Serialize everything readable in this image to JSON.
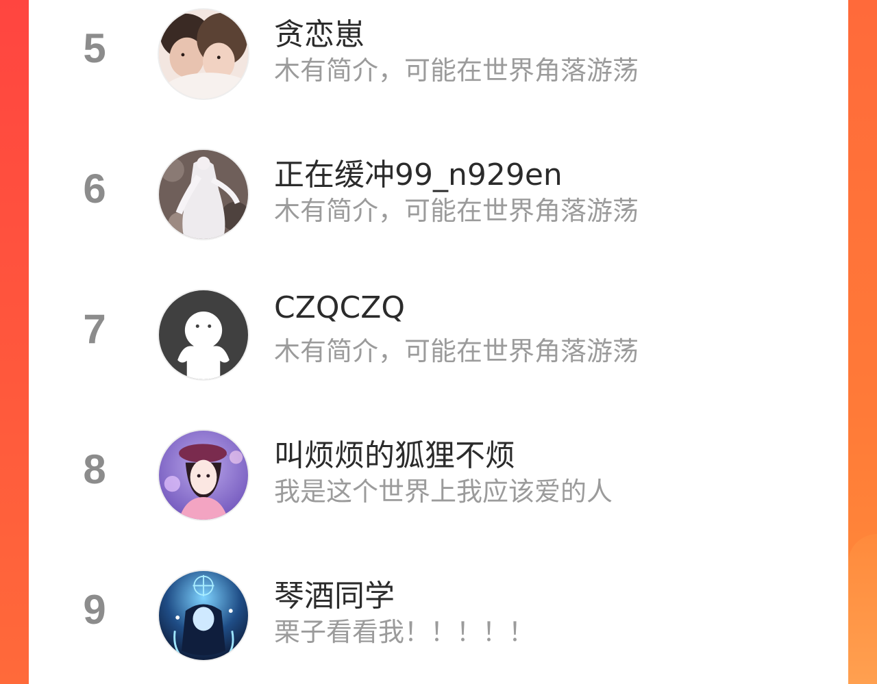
{
  "users": [
    {
      "rank": "5",
      "name": "贪恋崽",
      "bio": "木有简介，可能在世界角落游荡",
      "avatar_icon": "couple-photo-avatar"
    },
    {
      "rank": "6",
      "name": "正在缓冲99_n929en",
      "bio": "木有简介，可能在世界角落游荡",
      "avatar_icon": "white-dress-photo-avatar"
    },
    {
      "rank": "7",
      "name": "CZQCZQ",
      "bio": "木有简介，可能在世界角落游荡",
      "avatar_icon": "default-ghost-avatar"
    },
    {
      "rank": "8",
      "name": "叫烦烦的狐狸不烦",
      "bio": "我是这个世界上我应该爱的人",
      "avatar_icon": "anime-girl-avatar"
    },
    {
      "rank": "9",
      "name": "琴酒同学",
      "bio": "栗子看看我！！！！！",
      "avatar_icon": "dark-anime-avatar"
    }
  ],
  "colors": {
    "accent_left": "#ff4540",
    "accent_right": "#ff8a3a",
    "name_text": "#2b2b2b",
    "bio_text": "#9b9b9b",
    "rank_text": "#8c8c8c"
  }
}
